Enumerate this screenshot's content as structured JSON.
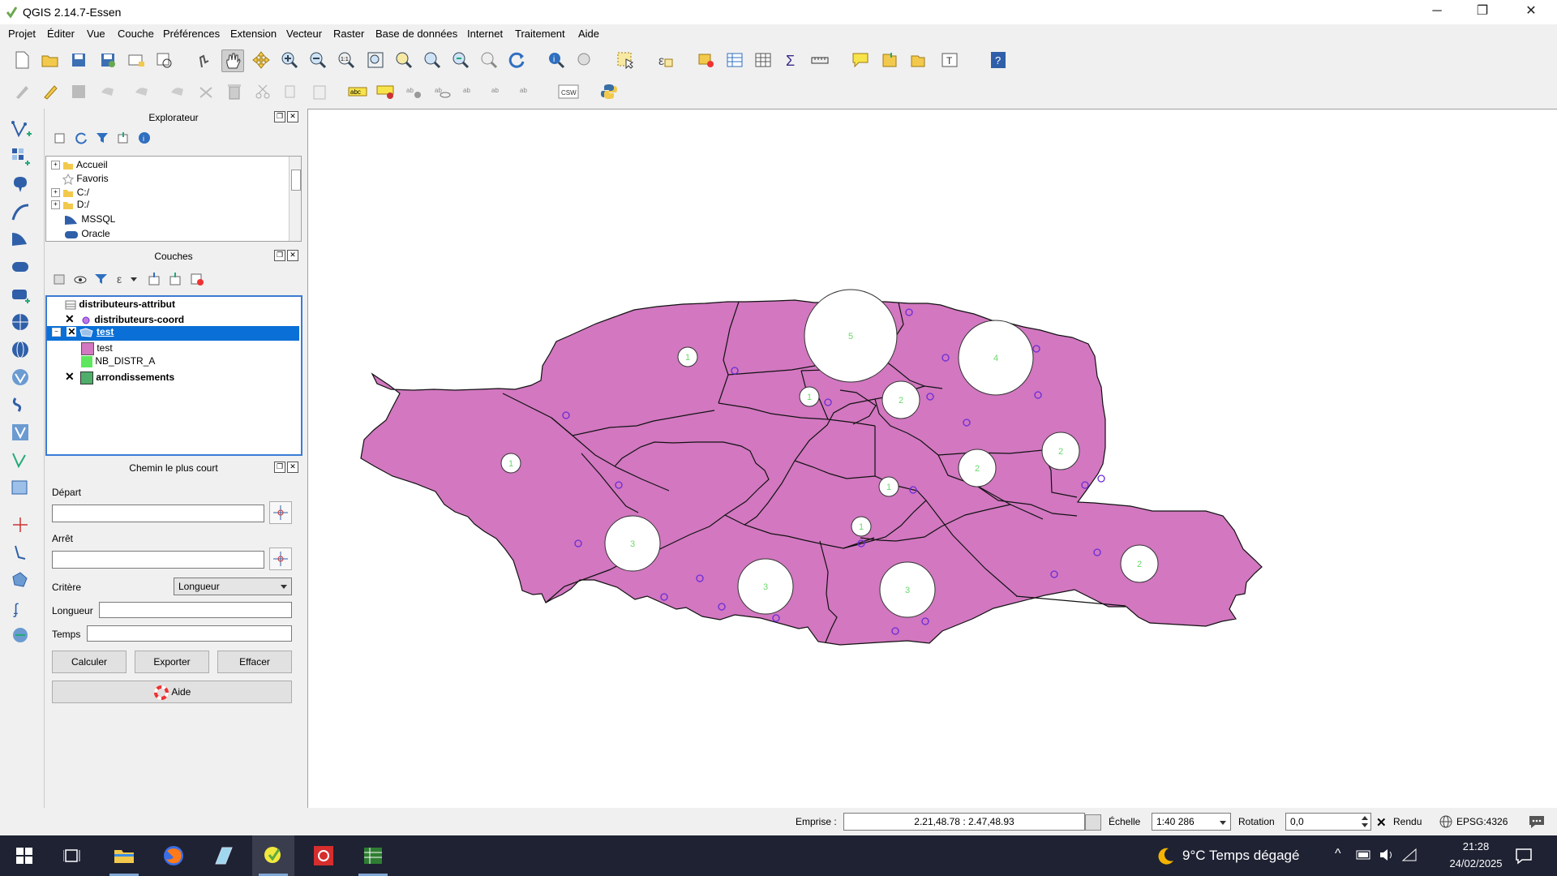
{
  "window": {
    "title": "QGIS 2.14.7-Essen",
    "minimize": "─",
    "maximize": "❐",
    "close": "✕"
  },
  "menu": [
    "Projet",
    "Éditer",
    "Vue",
    "Couche",
    "Préférences",
    "Extension",
    "Vecteur",
    "Raster",
    "Base de données",
    "Internet",
    "Traitement",
    "Aide"
  ],
  "browser": {
    "title": "Explorateur",
    "items": [
      "Accueil",
      "Favoris",
      "C:/",
      "D:/",
      "MSSQL",
      "Oracle"
    ]
  },
  "layers": {
    "title": "Couches",
    "items": [
      "distributeurs-attribut",
      "distributeurs-coord",
      "test",
      "test",
      "NB_DISTR_A",
      "arrondissements"
    ]
  },
  "shortest_path": {
    "title": "Chemin le plus court",
    "start_label": "Départ",
    "stop_label": "Arrêt",
    "criterion_label": "Critère",
    "criterion_value": "Longueur",
    "length_label": "Longueur",
    "time_label": "Temps",
    "compute": "Calculer",
    "export": "Exporter",
    "clear": "Effacer",
    "help": "Aide"
  },
  "map": {
    "district_color": "#d277c0",
    "point_color": "#6a2bd8",
    "label_color": "#6ad86a",
    "diagram_labels": [
      "5",
      "4",
      "1",
      "1",
      "2",
      "1",
      "2",
      "2",
      "1",
      "1",
      "3",
      "3",
      "3",
      "2"
    ]
  },
  "status": {
    "extent_label": "Emprise :",
    "extent_value": "2.21,48.78 : 2.47,48.93",
    "scale_label": "Échelle",
    "scale_value": "1:40 286",
    "rotation_label": "Rotation",
    "rotation_value": "0,0",
    "render_label": "Rendu",
    "crs": "EPSG:4326"
  },
  "taskbar": {
    "weather": "9°C  Temps dégagé",
    "time": "21:28",
    "date": "24/02/2025"
  }
}
